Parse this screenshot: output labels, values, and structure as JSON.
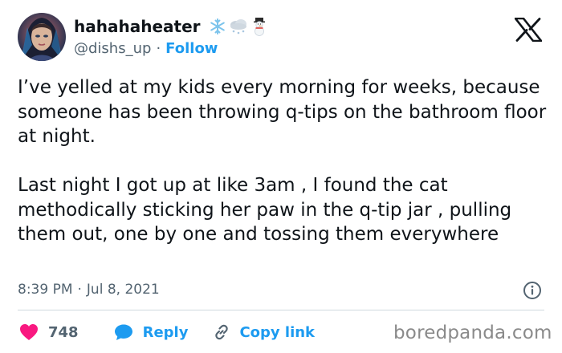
{
  "user": {
    "display_name": "hahahaheater",
    "handle": "@dishs_up",
    "separator": "·",
    "follow_label": "Follow",
    "emoji_icons": [
      "snowflake-icon",
      "snow-cloud-icon",
      "snowman-icon"
    ]
  },
  "tweet": {
    "paragraph_1": "I’ve yelled at my kids every morning for weeks, because someone has been throwing q-tips on the bathroom floor at night.",
    "paragraph_2": "Last night I got up at like 3am , I found the cat methodically sticking her paw in the q-tip jar , pulling them out, one by one and tossing them everywhere",
    "time": "8:39 PM",
    "separator": "·",
    "date": "Jul 8, 2021"
  },
  "actions": {
    "like_count": "748",
    "reply_label": "Reply",
    "copy_label": "Copy link"
  },
  "watermark": "boredpanda.com",
  "colors": {
    "text": "#0f1419",
    "secondary": "#536471",
    "accent": "#1d9bf0",
    "like": "#f91880",
    "divider": "#cfd9de"
  }
}
